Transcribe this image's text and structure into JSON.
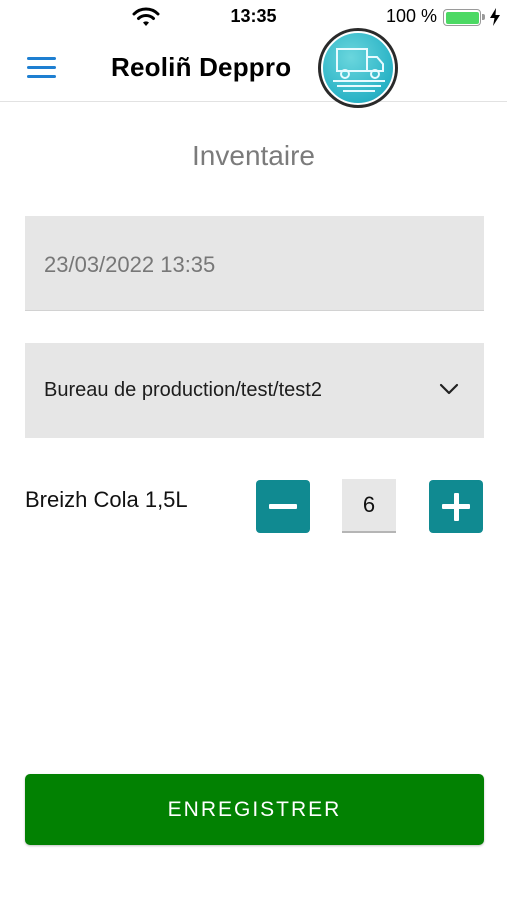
{
  "status_bar": {
    "time": "13:35",
    "battery_percent": "100 %",
    "battery_level": 1.0,
    "icons": [
      "wifi-icon",
      "battery-icon",
      "charging-bolt-icon"
    ]
  },
  "header": {
    "title": "Reoliñ Deppro",
    "menu_icon": "hamburger-menu-icon",
    "logo_icon": "truck-logo-icon",
    "accent_color": "#1e7fd1"
  },
  "page": {
    "title": "Inventaire"
  },
  "form": {
    "datetime_value": "23/03/2022 13:35",
    "location_value": "Bureau de production/test/test2",
    "location_icon": "chevron-down-icon"
  },
  "items": [
    {
      "label": "Breizh Cola 1,5L",
      "quantity": "6",
      "decrement_icon": "minus-icon",
      "increment_icon": "plus-icon"
    }
  ],
  "actions": {
    "save_label": "ENREGISTRER"
  },
  "colors": {
    "stepper": "#108a91",
    "save": "#028102",
    "battery": "#4cd964"
  }
}
